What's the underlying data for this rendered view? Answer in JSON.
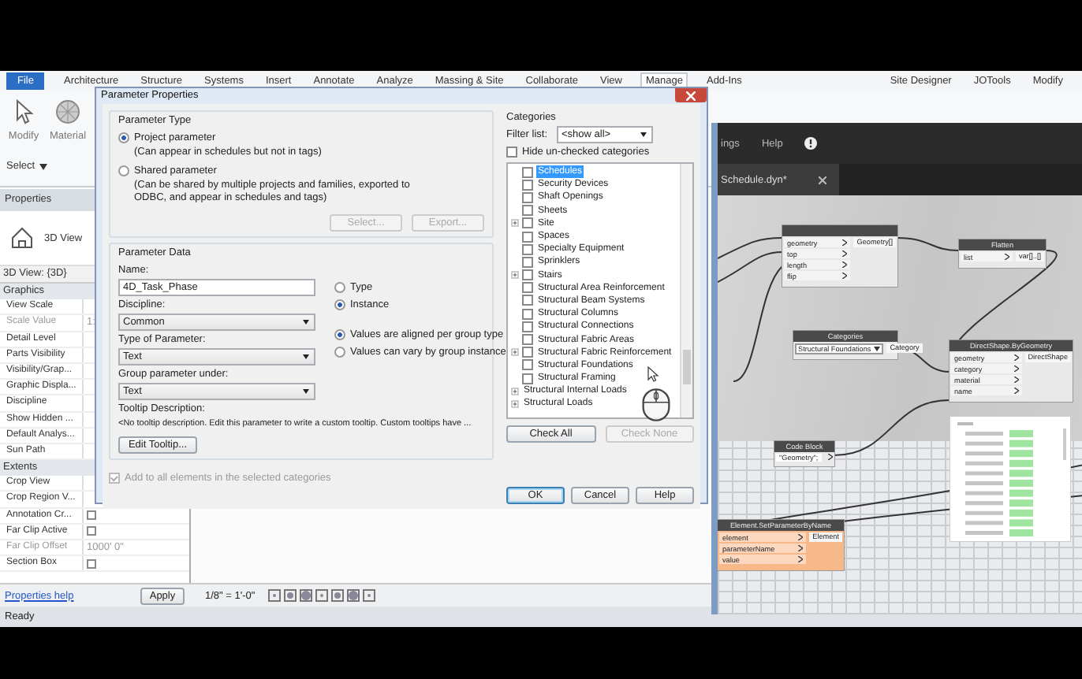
{
  "ribbon": {
    "tabs": [
      {
        "label": "File",
        "kind": "application",
        "selected": false
      },
      {
        "label": "Architecture",
        "kind": "tab",
        "selected": false
      },
      {
        "label": "Structure",
        "kind": "tab",
        "selected": false
      },
      {
        "label": "Systems",
        "kind": "tab",
        "selected": false
      },
      {
        "label": "Insert",
        "kind": "tab",
        "selected": false
      },
      {
        "label": "Annotate",
        "kind": "tab",
        "selected": false
      },
      {
        "label": "Analyze",
        "kind": "tab",
        "selected": false
      },
      {
        "label": "Massing & Site",
        "kind": "tab",
        "selected": false
      },
      {
        "label": "Collaborate",
        "kind": "tab",
        "selected": false
      },
      {
        "label": "View",
        "kind": "tab",
        "selected": false
      },
      {
        "label": "Manage",
        "kind": "tab",
        "selected": true
      },
      {
        "label": "Add-Ins",
        "kind": "tab",
        "selected": false
      }
    ],
    "addin_tabs": [
      "Site Designer",
      "JOTools",
      "Modify"
    ],
    "tools": [
      {
        "label": "Modify",
        "kind": "cursor"
      },
      {
        "label": "Material",
        "kind": "sphere"
      }
    ],
    "select": "Select"
  },
  "properties": {
    "title": "Properties",
    "type_name": "3D View",
    "view_selector": "3D View: {3D}",
    "rows": [
      {
        "kind": "group",
        "label": "Graphics"
      },
      {
        "kind": "param",
        "label": "View Scale",
        "disabled": false
      },
      {
        "kind": "value",
        "label": "Scale Value",
        "value": "1:",
        "disabled": true
      },
      {
        "kind": "param",
        "label": "Detail Level",
        "disabled": false
      },
      {
        "kind": "param",
        "label": "Parts Visibility",
        "disabled": false
      },
      {
        "kind": "param",
        "label": "Visibility/Grap...",
        "disabled": false
      },
      {
        "kind": "param",
        "label": "Graphic Displa...",
        "disabled": false
      },
      {
        "kind": "param",
        "label": "Discipline",
        "disabled": false
      },
      {
        "kind": "param",
        "label": "Show Hidden ...",
        "disabled": false
      },
      {
        "kind": "param",
        "label": "Default Analys...",
        "disabled": false
      },
      {
        "kind": "param",
        "label": "Sun Path",
        "disabled": false
      },
      {
        "kind": "group",
        "label": "Extents"
      },
      {
        "kind": "param",
        "label": "Crop View",
        "disabled": false
      },
      {
        "kind": "param",
        "label": "Crop Region V...",
        "disabled": false
      },
      {
        "kind": "checkbox",
        "label": "Annotation Cr...",
        "checked": false,
        "disabled": false
      },
      {
        "kind": "checkbox",
        "label": "Far Clip Active",
        "checked": false,
        "disabled": false
      },
      {
        "kind": "value",
        "label": "Far Clip Offset",
        "value": "1000' 0\"",
        "disabled": true
      },
      {
        "kind": "checkbox",
        "label": "Section Box",
        "checked": false,
        "disabled": false
      }
    ],
    "help_link": "Properties help",
    "apply": "Apply"
  },
  "view_bar": {
    "scale": "1/8\" = 1'-0\""
  },
  "status_bar": "Ready",
  "dialog": {
    "title": "Parameter Properties",
    "parameter_type": {
      "heading": "Parameter Type",
      "options": [
        {
          "label": "Project parameter",
          "note": "(Can appear in schedules but not in tags)",
          "selected": true
        },
        {
          "label": "Shared parameter",
          "note": "(Can be shared by multiple projects and families, exported to ODBC, and appear in schedules and tags)",
          "selected": false
        }
      ],
      "buttons": [
        {
          "label": "Select...",
          "disabled": true
        },
        {
          "label": "Export...",
          "disabled": true
        }
      ]
    },
    "parameter_data": {
      "heading": "Parameter Data",
      "name_label": "Name:",
      "name": "4D_Task_Phase",
      "scope": [
        {
          "label": "Type",
          "selected": false
        },
        {
          "label": "Instance",
          "selected": true
        }
      ],
      "discipline_label": "Discipline:",
      "discipline": "Common",
      "type_label": "Type of Parameter:",
      "type": "Text",
      "group_options": [
        {
          "label": "Values are aligned per group type",
          "selected": true
        },
        {
          "label": "Values can vary by group instance",
          "selected": false
        }
      ],
      "group_label": "Group parameter under:",
      "group": "Text",
      "tooltip_label": "Tooltip Description:",
      "tooltip": "<No tooltip description. Edit this parameter to write a custom tooltip. Custom tooltips have ...",
      "edit_tooltip": "Edit Tooltip..."
    },
    "add_to_all": {
      "label": "Add to all elements in the selected categories",
      "checked": true,
      "disabled": true
    },
    "categories": {
      "heading": "Categories",
      "filter_label": "Filter list:",
      "filter": "<show all>",
      "hide_unchecked": {
        "label": "Hide un-checked categories",
        "checked": false
      },
      "items": [
        {
          "kind": "category",
          "label": "Schedules",
          "checked": false,
          "selected": true,
          "expandable": false
        },
        {
          "kind": "category",
          "label": "Security Devices",
          "checked": false,
          "selected": false,
          "expandable": false
        },
        {
          "kind": "category",
          "label": "Shaft Openings",
          "checked": false,
          "selected": false,
          "expandable": false
        },
        {
          "kind": "category",
          "label": "Sheets",
          "checked": false,
          "selected": false,
          "expandable": false
        },
        {
          "kind": "category",
          "label": "Site",
          "checked": false,
          "selected": false,
          "expandable": true
        },
        {
          "kind": "category",
          "label": "Spaces",
          "checked": false,
          "selected": false,
          "expandable": false
        },
        {
          "kind": "category",
          "label": "Specialty Equipment",
          "checked": false,
          "selected": false,
          "expandable": false
        },
        {
          "kind": "category",
          "label": "Sprinklers",
          "checked": false,
          "selected": false,
          "expandable": false
        },
        {
          "kind": "category",
          "label": "Stairs",
          "checked": false,
          "selected": false,
          "expandable": true
        },
        {
          "kind": "category",
          "label": "Structural Area Reinforcement",
          "checked": false,
          "selected": false,
          "expandable": false
        },
        {
          "kind": "category",
          "label": "Structural Beam Systems",
          "checked": false,
          "selected": false,
          "expandable": false
        },
        {
          "kind": "category",
          "label": "Structural Columns",
          "checked": false,
          "selected": false,
          "expandable": false
        },
        {
          "kind": "category",
          "label": "Structural Connections",
          "checked": false,
          "selected": false,
          "expandable": false
        },
        {
          "kind": "category",
          "label": "Structural Fabric Areas",
          "checked": false,
          "selected": false,
          "expandable": false
        },
        {
          "kind": "category",
          "label": "Structural Fabric Reinforcement",
          "checked": false,
          "selected": false,
          "expandable": true
        },
        {
          "kind": "category",
          "label": "Structural Foundations",
          "checked": false,
          "selected": false,
          "expandable": false
        },
        {
          "kind": "category",
          "label": "Structural Framing",
          "checked": false,
          "selected": false,
          "expandable": false
        },
        {
          "kind": "group",
          "label": "Structural Internal Loads",
          "selected": false,
          "expandable": true
        },
        {
          "kind": "group",
          "label": "Structural Loads",
          "selected": false,
          "expandable": true
        }
      ],
      "buttons": [
        {
          "label": "Check All",
          "disabled": false
        },
        {
          "label": "Check None",
          "disabled": true
        }
      ]
    },
    "footer_buttons": [
      {
        "label": "OK",
        "default": true
      },
      {
        "label": "Cancel",
        "default": false
      },
      {
        "label": "Help",
        "default": false
      }
    ]
  },
  "dynamo": {
    "menu": [
      "ings",
      "Help"
    ],
    "tab": "Schedule.dyn*",
    "nodes": [
      {
        "kind": "standard",
        "warning": false,
        "inputs": [
          "geometry",
          "top",
          "length",
          "flip"
        ],
        "outputs": [
          "Geometry[]"
        ]
      },
      {
        "kind": "standard",
        "title": "Flatten",
        "warning": false,
        "inputs": [
          "list"
        ],
        "outputs": [
          "var[]..[]"
        ]
      },
      {
        "kind": "dropdown",
        "title": "Categories",
        "value": "Structural Foundations",
        "warning": false,
        "outputs": [
          "Category"
        ]
      },
      {
        "kind": "standard",
        "title": "DirectShape.ByGeometry",
        "warning": false,
        "inputs": [
          "geometry",
          "category",
          "material",
          "name"
        ],
        "outputs": [
          "DirectShape"
        ]
      },
      {
        "kind": "code",
        "title": "Code Block",
        "code": "\"Geometry\";",
        "warning": false
      },
      {
        "kind": "standard",
        "title": "Element.SetParameterByName",
        "warning": true,
        "inputs": [
          "element",
          "parameterName",
          "value"
        ],
        "outputs": [
          "Element"
        ]
      }
    ]
  }
}
